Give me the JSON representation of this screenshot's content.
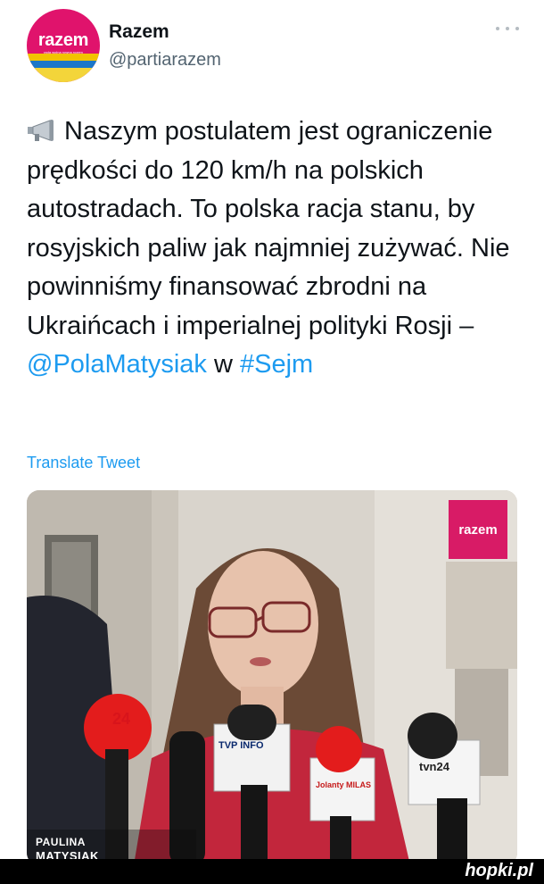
{
  "account": {
    "display_name": "Razem",
    "handle": "@partiarazem",
    "avatar_text": "razem",
    "avatar_subtext": "rada wolna rowna rozem",
    "brand_color": "#e0136c"
  },
  "tweet": {
    "emoji_icon": "megaphone-icon",
    "text_before_mention": "Naszym postulatem jest ograniczenie prędkości do 120 km/h na polskich autostradach. To polska racja stanu, by rosyjskich paliw jak najmniej zużywać. Nie powinniśmy finansować zbrodni na Ukraińcach i imperialnej polityki Rosji –",
    "mention": "@PolaMatysiak",
    "connector": "w",
    "hashtag": "#Sejm",
    "link_color": "#1d9bf0"
  },
  "translate_label": "Translate Tweet",
  "media": {
    "badge_text": "razem",
    "caption_first_name": "PAULINA",
    "caption_last_name": "MATYSIAK",
    "mic_labels": {
      "polskie_radio": "24",
      "tvp": "TVP INFO",
      "radio_milas": "Jolanty MILAS",
      "tvn": "tvn24"
    }
  },
  "watermark": "hopki.pl"
}
